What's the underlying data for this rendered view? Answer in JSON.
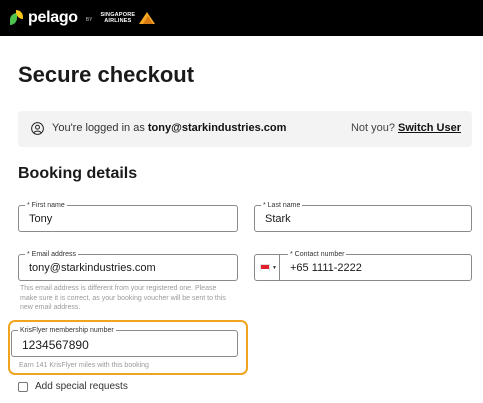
{
  "header": {
    "brand": "pelago",
    "by": "BY",
    "partner_line1": "SINGAPORE",
    "partner_line2": "AIRLINES"
  },
  "page_title": "Secure checkout",
  "login": {
    "prefix": "You're logged in as ",
    "email": "tony@starkindustries.com",
    "not_you": "Not you? ",
    "switch_label": "Switch User"
  },
  "booking": {
    "title": "Booking details",
    "first_name": {
      "label": "* First name",
      "value": "Tony"
    },
    "last_name": {
      "label": "* Last name",
      "value": "Stark"
    },
    "email": {
      "label": "* Email address",
      "value": "tony@starkindustries.com",
      "helper": "This email address is different from your registered one. Please make sure it is correct, as your booking voucher will be sent to this new email address."
    },
    "contact": {
      "label": "* Contact number",
      "value": "+65 1111-2222",
      "country": "SG"
    },
    "krisflyer": {
      "label": "KrisFlyer membership number",
      "value": "1234567890",
      "helper": "Earn 141 KrisFlyer miles with this booking"
    },
    "special_requests_label": "Add special requests"
  },
  "colors": {
    "highlight": "#f0a51e",
    "header_bg": "#000000"
  }
}
